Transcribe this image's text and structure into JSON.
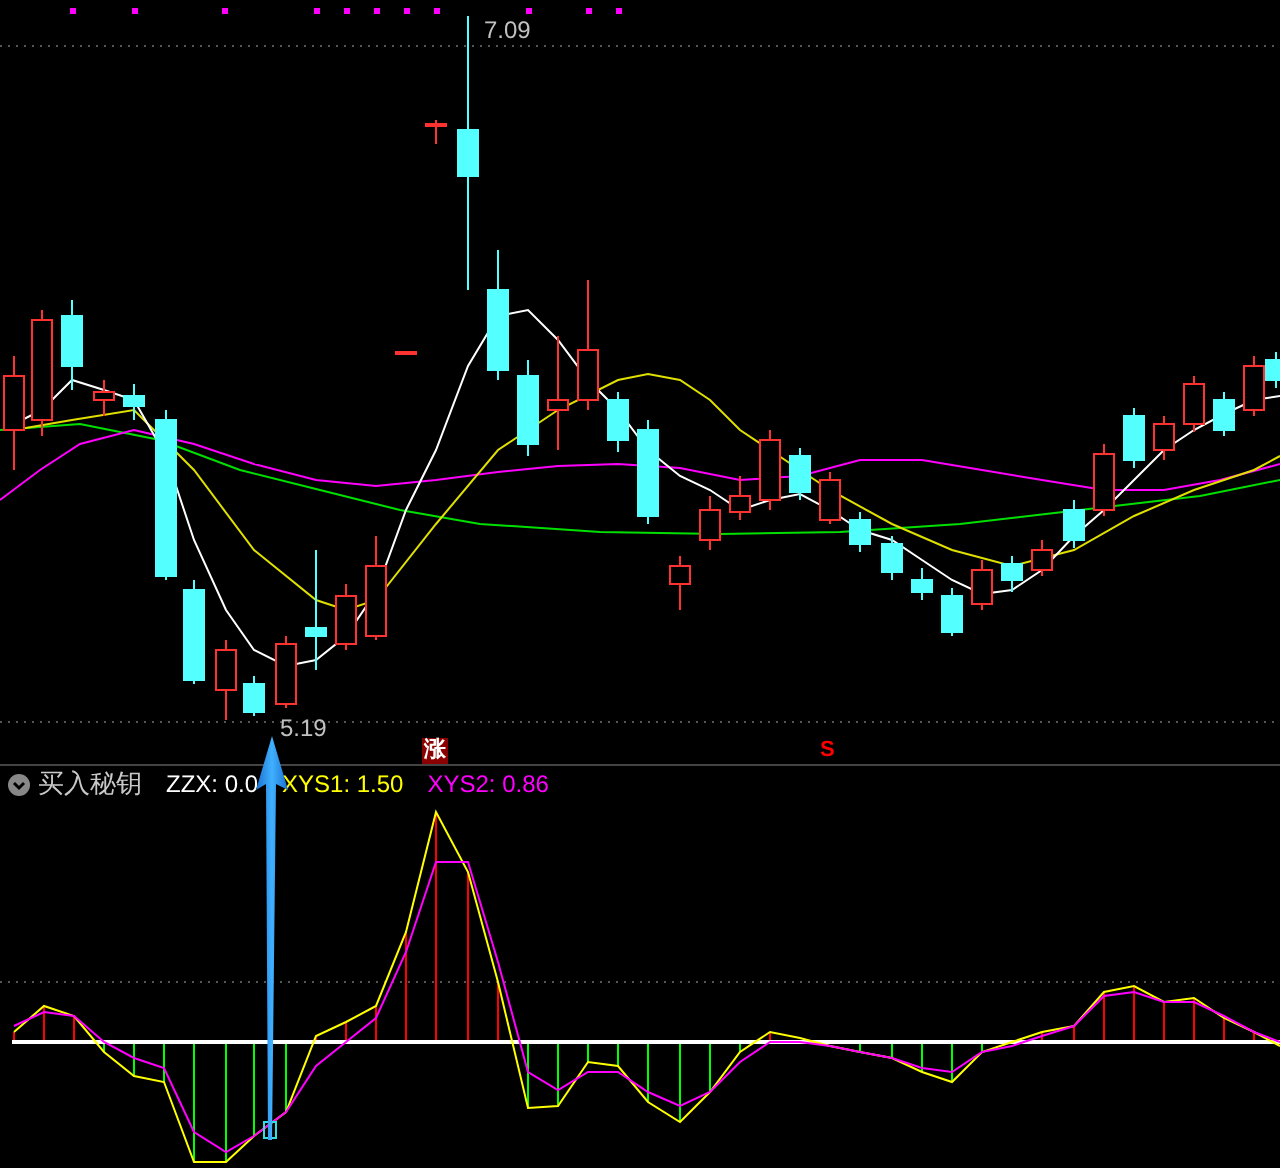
{
  "main_chart": {
    "high_label": "7.09",
    "low_label": "5.19",
    "signals": [
      {
        "kind": "rise",
        "label": "涨"
      },
      {
        "kind": "sell",
        "label": "S"
      }
    ]
  },
  "indicator": {
    "name": "买入秘钥",
    "values": [
      {
        "label": "ZZX: 0.0",
        "color": "#ffffff"
      },
      {
        "label": "XYS1: 1.50",
        "color": "#ffff00"
      },
      {
        "label": "XYS2: 0.86",
        "color": "#ff00ff"
      }
    ]
  }
}
